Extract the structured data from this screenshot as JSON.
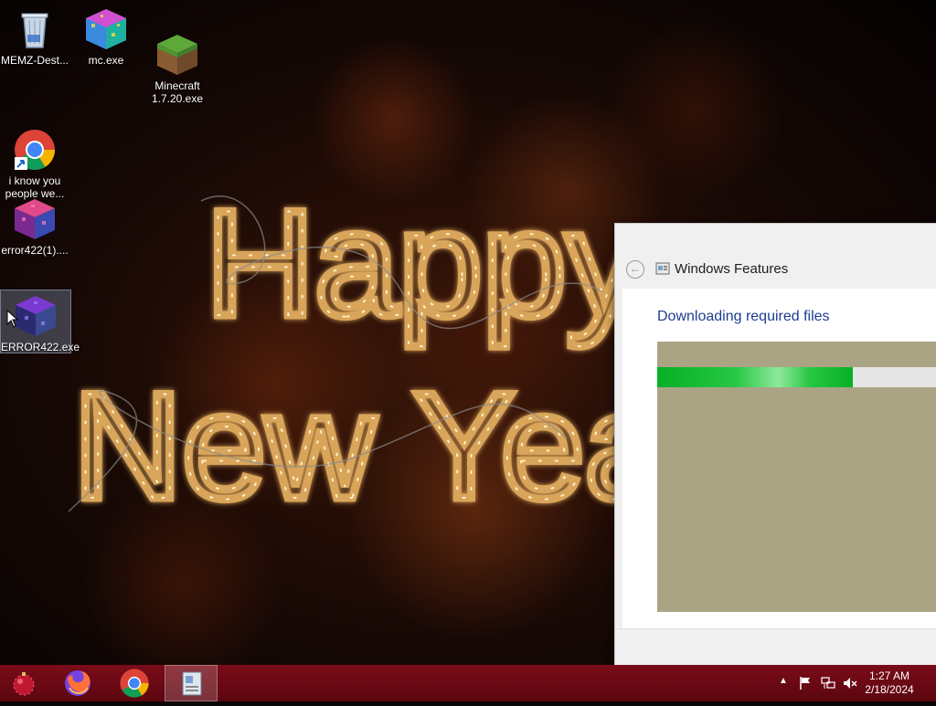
{
  "desktop": {
    "icons": [
      {
        "label": "MEMZ-Dest...",
        "icon": "recycle-bin-icon"
      },
      {
        "label": "mc.exe",
        "icon": "colorful-cube-icon"
      },
      {
        "label": "Minecraft\n1.7.20.exe",
        "icon": "grass-block-icon"
      },
      {
        "label": "i know you\npeople we...",
        "icon": "chrome-shortcut-icon"
      },
      {
        "label": "error422(1)....",
        "icon": "pink-cube-icon"
      },
      {
        "label": "ERROR422.exe",
        "icon": "purple-cube-icon"
      }
    ],
    "wallpaper_text": [
      "Happy",
      "New Year"
    ]
  },
  "window": {
    "title": "Windows Features",
    "subheading": "Downloading required files",
    "progress": 0.7,
    "colors": {
      "progress": "#06b025",
      "panel": "#aaa484",
      "heading": "#1b3e8e"
    }
  },
  "taskbar": {
    "apps": [
      "start-orb-icon",
      "firefox-icon",
      "chrome-icon",
      "windows-features-icon"
    ],
    "tray": [
      "show-hidden-icons",
      "action-center-flag-icon",
      "network-icon",
      "volume-muted-icon"
    ],
    "clock": {
      "time": "1:27 AM",
      "date": "2/18/2024"
    },
    "color": "#6e0a15"
  }
}
